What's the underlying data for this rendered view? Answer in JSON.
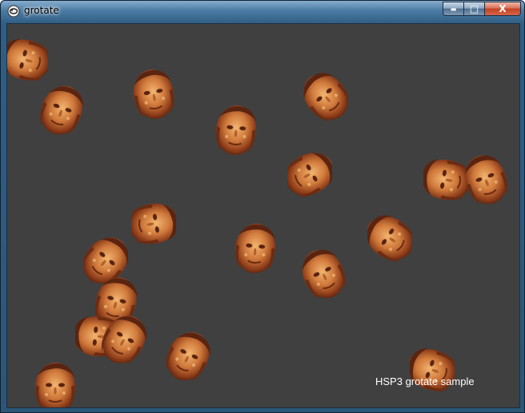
{
  "window": {
    "title": "grotate",
    "app_icon": "hsp-app-icon",
    "controls": {
      "minimize_icon": "minimize-icon",
      "maximize_icon": "maximize-icon",
      "close_icon": "close-icon",
      "minimize_glyph": "▬",
      "maximize_glyph": "□",
      "close_glyph": "X"
    }
  },
  "canvas": {
    "background": "#404040",
    "caption": "HSP3 grotate sample",
    "sprite_icon": "rotated-face-sprite"
  }
}
